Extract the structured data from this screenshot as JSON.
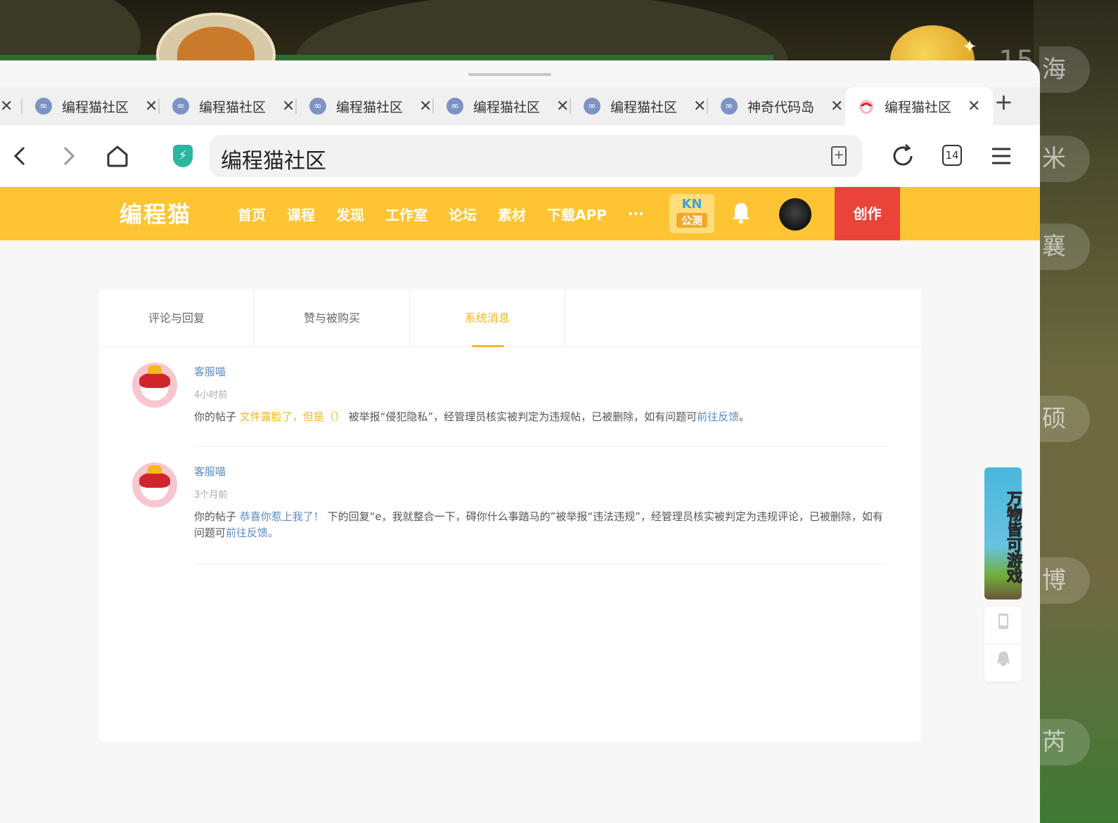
{
  "background": {
    "side_chars": [
      "海",
      "米",
      "襄",
      "硕",
      "博",
      "芮"
    ],
    "counter": "15"
  },
  "browser": {
    "tabs": [
      {
        "title": "编程猫社区",
        "icon": "link-icon"
      },
      {
        "title": "编程猫社区",
        "icon": "link-icon"
      },
      {
        "title": "编程猫社区",
        "icon": "link-icon"
      },
      {
        "title": "编程猫社区",
        "icon": "link-icon"
      },
      {
        "title": "编程猫社区",
        "icon": "link-icon"
      },
      {
        "title": "神奇代码岛",
        "icon": "link-icon"
      },
      {
        "title": "编程猫社区",
        "icon": "codemao-icon",
        "active": true
      }
    ],
    "close_glyph": "✕",
    "new_tab_glyph": "+",
    "address": "编程猫社区",
    "tab_count": "14"
  },
  "site": {
    "logo": "编程猫",
    "nav": [
      "首页",
      "课程",
      "发现",
      "工作室",
      "论坛",
      "素材",
      "下载APP",
      "···"
    ],
    "kn_top": "KN",
    "kn_bottom": "公测",
    "create": "创作",
    "accent": "#fec433",
    "create_color": "#ea4339"
  },
  "messages_page": {
    "tabs": [
      "评论与回复",
      "赞与被购买",
      "系统消息"
    ],
    "active_tab": 2,
    "items": [
      {
        "sender": "客服喵",
        "time": "4小时前",
        "prefix": "你的帖子 ",
        "post": "文件露脸了，但是（）",
        "suffix": " 被举报“侵犯隐私”，经管理员核实被判定为违规帖，已被删除，如有问题可",
        "link": "前往反馈",
        "end": "。"
      },
      {
        "sender": "客服喵",
        "time": "3个月前",
        "prefix": "你的帖子 ",
        "post": "恭喜你惹上我了！",
        "suffix": " 下的回复“e，我就整合一下，碍你什么事踏马的”被举报“违法违规”，经管理员核实被判定为违规评论，已被删除，如有问题可",
        "link": "前往反馈。",
        "end": ""
      }
    ]
  },
  "side_widgets": {
    "promo": "万物皆可游戏",
    "tools": [
      "tablet-icon",
      "qq-penguin-icon"
    ]
  }
}
